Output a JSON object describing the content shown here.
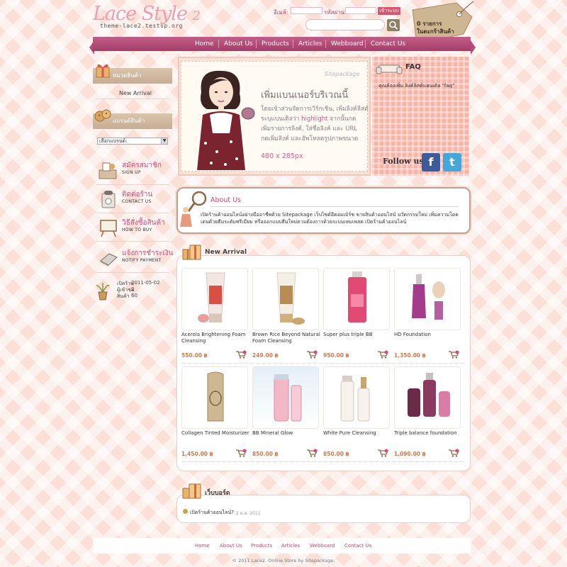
{
  "header": {
    "logo_main": "Lace Style",
    "logo_num": "2",
    "logo_sub": "theme-lace2.testsp.org",
    "login": {
      "email_label": "อีเมล์:",
      "password_label": "รหัสผ่าน:",
      "login_button": "เข้าระบบ"
    },
    "cart": {
      "line1": "0 รายการ",
      "line2": "ในตะกร้าสินค้า"
    }
  },
  "nav": {
    "items": [
      "Home",
      "About Us",
      "Products",
      "Articles",
      "Webboard",
      "Contact Us"
    ]
  },
  "sidebar": {
    "category_head": "หมวดสินค้า",
    "category_items": [
      "New Arrival"
    ],
    "brand_head": "แบรนด์สินค้า",
    "brand_select": "เลือกแบรนด์:",
    "menus": [
      {
        "th": "สมัครสมาชิก",
        "en": "SIGN UP"
      },
      {
        "th": "ติดต่อร้าน",
        "en": "CONTACT US"
      },
      {
        "th": "วิธีสั่งซื้อสินค้า",
        "en": "HOW TO BUY"
      },
      {
        "th": "แจ้งการชำระเงิน",
        "en": "NOTIFY PAYMENT"
      }
    ],
    "stats": {
      "opened_label": "เปิดร้าน",
      "opened_value": "2011-05-02",
      "visitors_label": "ผู้เข้าชม",
      "visitors_value": "2",
      "products_label": "สินค้า",
      "products_value": "60"
    }
  },
  "banner": {
    "watermark": "Sitepackage",
    "title": "เพิ่มแบนเนอร์บริเวณนี้",
    "line1": "โดยเข้าส่วนจัดการเวิร์กเชิน, เพิ่มลิงค์ลิสต์",
    "line2_a": "ระบุแบนเดิลว่า ",
    "line2_hl": "highlight",
    "line2_b": " จากนั้นกด",
    "line3": "เพิ่มรายการลิงค์, ใส่ชื่อลิงค์ และ URL",
    "line4": "กดเพิ่มลิงค์ และอัพโหลดรูปภาพขนาด",
    "size": "480 x 285px"
  },
  "faq": {
    "title": "FAQ",
    "text": "คุณต้องเพิ่ม ลิงค์ลิสต์แฮนเดิล \"faq\"",
    "follow": "Follow us",
    "facebook": "f",
    "twitter": "t"
  },
  "about": {
    "title": "About Us",
    "text": "เปิดร้านค้าออนไลน์อย่างมืออาชีพด้วย Sitepackage เว็บไซต์อีคอมเมิร์ช ขายสินค้าออนไลน์ นวัตกรรมใหม่ เพิ่มความโดดเด่นด้วยธีมระดับพรีเมียม หรือออกแบบธีมใหม่ตามต้องการด้วยระบบเทมเพลต เปิดร้านค้าออนไลน์"
  },
  "arrival": {
    "title": "New Arrival",
    "products": [
      {
        "name": "Acerola Brightening Foam Cleansing",
        "price": "550.00 ฿"
      },
      {
        "name": "Brown Rice Beyond Natural Foam Cleansing",
        "price": "249.00 ฿"
      },
      {
        "name": "Super plus triple BB",
        "price": "950.00 ฿"
      },
      {
        "name": "HD Foundation",
        "price": "1,350.00 ฿"
      },
      {
        "name": "Collagen Tinted Moisturizer",
        "price": "1,450.00 ฿"
      },
      {
        "name": "BB Mineral Glow",
        "price": "850.00 ฿"
      },
      {
        "name": "White Pure Cleansing",
        "price": "850.00 ฿"
      },
      {
        "name": "Triple balance foundation",
        "price": "1,090.00 ฿"
      }
    ]
  },
  "webboard": {
    "title": "เว็บบอร์ด",
    "post_title": "เปิดร้านค้าออนไลน์?",
    "post_date": "2 ต.ค. 2011"
  },
  "footer": {
    "links": [
      "Home",
      "About Us",
      "Products",
      "Articles",
      "Webboard",
      "Contact Us"
    ],
    "copyright": "© 2011 Lace2. Online Store by Sitepackage."
  },
  "colors": {
    "accent": "#d24e7d",
    "nav": "#b24e78",
    "price": "#d07a4a"
  }
}
